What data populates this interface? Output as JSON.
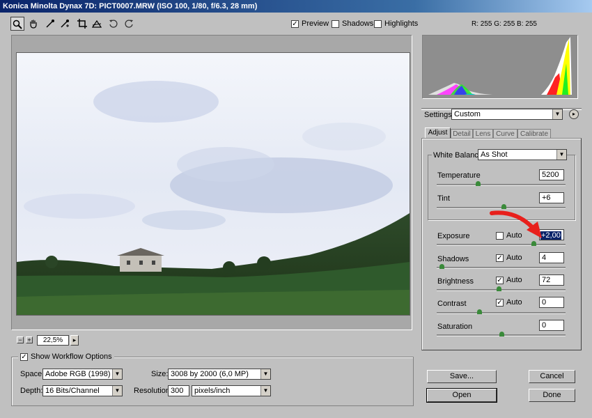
{
  "window": {
    "title": "Konica Minolta Dynax 7D:  PICT0007.MRW  (ISO 100, 1/80, f/6.3, 28 mm)"
  },
  "toolbar": {
    "tools": [
      {
        "name": "zoom-tool",
        "icon": "magnifier-icon",
        "glyph": "🔍"
      },
      {
        "name": "hand-tool",
        "icon": "hand-icon",
        "glyph": "✋"
      },
      {
        "name": "white-balance-tool",
        "icon": "eyedropper-icon",
        "glyph": "⟋"
      },
      {
        "name": "color-sampler-tool",
        "icon": "sampler-icon",
        "glyph": "⟋"
      },
      {
        "name": "crop-tool",
        "icon": "crop-icon",
        "glyph": "⌗"
      },
      {
        "name": "straighten-tool",
        "icon": "straighten-icon",
        "glyph": "△"
      },
      {
        "name": "rotate-left-tool",
        "icon": "rotate-left-icon",
        "glyph": "↺"
      },
      {
        "name": "rotate-right-tool",
        "icon": "rotate-right-icon",
        "glyph": "↻"
      }
    ],
    "preview": {
      "label": "Preview",
      "checked": "✓"
    },
    "shadows": {
      "label": "Shadows",
      "checked": ""
    },
    "highlights": {
      "label": "Highlights",
      "checked": ""
    },
    "rgb_readout": "R: 255   G: 255   B: 255"
  },
  "zoom": {
    "value": "22,5%",
    "minus": "−",
    "plus": "+",
    "arrow": "▸"
  },
  "workflow": {
    "title": "Show Workflow Options",
    "checked": "✓",
    "space_label": "Space:",
    "space_value": "Adobe RGB (1998)",
    "depth_label": "Depth:",
    "depth_value": "16 Bits/Channel",
    "size_label": "Size:",
    "size_value": "3008 by 2000  (6,0 MP)",
    "resolution_label": "Resolution:",
    "resolution_value": "300",
    "resolution_unit": "pixels/inch"
  },
  "settings": {
    "label": "Settings:",
    "value": "Custom",
    "menu_glyph": "▸"
  },
  "tabs": [
    "Adjust",
    "Detail",
    "Lens",
    "Curve",
    "Calibrate"
  ],
  "white_balance": {
    "label": "White Balance:",
    "value": "As Shot"
  },
  "adjust": {
    "temperature": {
      "label": "Temperature",
      "value": "5200",
      "level": 0.32
    },
    "tint": {
      "label": "Tint",
      "value": "+6",
      "level": 0.52
    },
    "exposure": {
      "label": "Exposure",
      "value": "+2,00",
      "auto_label": "Auto",
      "auto_checked": "",
      "level": 0.75
    },
    "shadows": {
      "label": "Shadows",
      "value": "4",
      "auto_label": "Auto",
      "auto_checked": "✓",
      "level": 0.04
    },
    "brightness": {
      "label": "Brightness",
      "value": "72",
      "auto_label": "Auto",
      "auto_checked": "✓",
      "level": 0.48
    },
    "contrast": {
      "label": "Contrast",
      "value": "0",
      "auto_label": "Auto",
      "auto_checked": "✓",
      "level": 0.33
    },
    "saturation": {
      "label": "Saturation",
      "value": "0",
      "level": 0.5
    }
  },
  "buttons": {
    "save": "Save...",
    "cancel": "Cancel",
    "open": "Open",
    "done": "Done"
  },
  "dropdown_glyph": "▼",
  "colors": {
    "title_start": "#0a246a",
    "title_end": "#a6caf0",
    "annotation_arrow": "#e8201c",
    "selection": "#0a246a"
  }
}
